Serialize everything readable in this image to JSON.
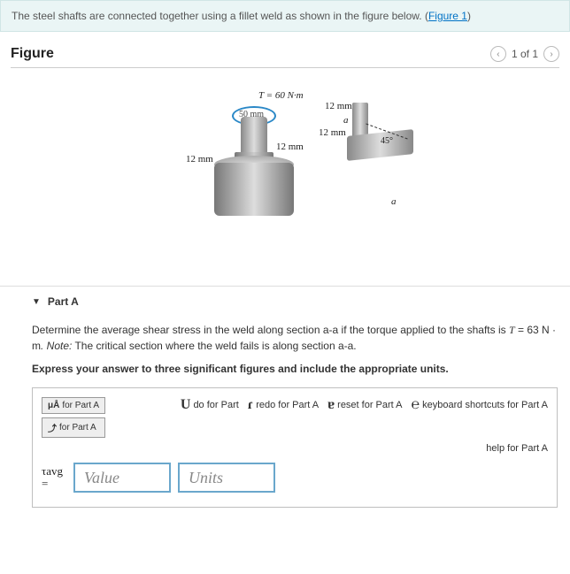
{
  "intro": {
    "text_before": "The steel shafts are connected together using a fillet weld as shown in the figure below. (",
    "link_text": "Figure 1",
    "text_after": ")"
  },
  "figure": {
    "title": "Figure",
    "pager_text": "1 of 1",
    "labels": {
      "torque": "T = 60 N·m",
      "diameter": "50 mm",
      "dim12_a": "12 mm",
      "dim12_b": "12 mm",
      "dim12_c": "12 mm",
      "dim12_d": "12 mm",
      "a1": "a",
      "a2": "a",
      "angle": "45°"
    }
  },
  "partA": {
    "title": "Part A",
    "question_before": "Determine the average shear stress in the weld along section a-a if the torque applied to the shafts is ",
    "T_sym": "T",
    "T_eq": " = 63 ",
    "T_units": "N · m",
    "note_label": ". Note:",
    "question_after": " The critical section where the weld fails is along section a-a.",
    "instruction": "Express your answer to three significant figures and include the appropriate units.",
    "toolbar": {
      "btn1": "for Part A",
      "btn2": "for Part A",
      "undo": "do for Part",
      "redo": "redo for Part A",
      "reset": "reset for Part A",
      "keyboard": "keyboard shortcuts for Part A",
      "help": "help for Part A"
    },
    "tau_label_top": "τavg",
    "tau_label_bottom": "=",
    "value_placeholder": "Value",
    "units_placeholder": "Units"
  }
}
